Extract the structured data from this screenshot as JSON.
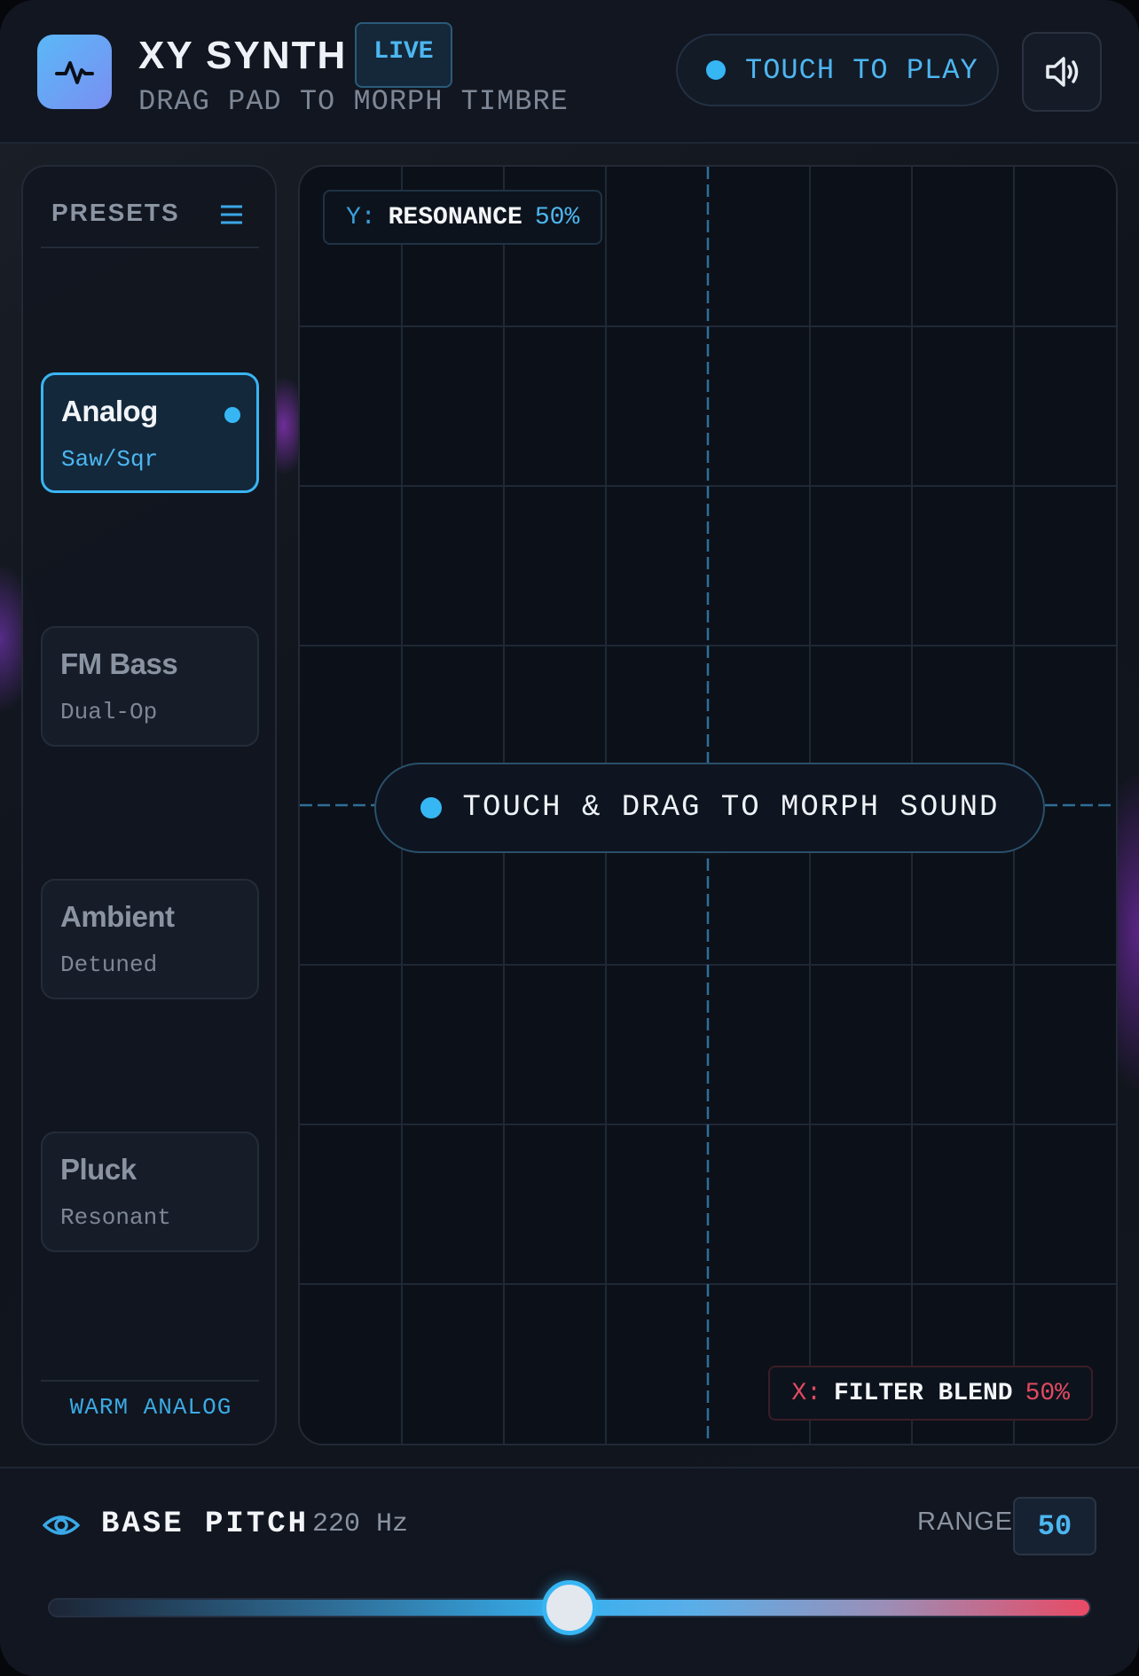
{
  "header": {
    "title": "XY SYNTH",
    "badge": "LIVE",
    "subtitle": "DRAG PAD TO MORPH TIMBRE",
    "touch_to_play": "TOUCH TO PLAY",
    "icons": {
      "logo": "pulse-icon",
      "sound": "speaker-icon"
    }
  },
  "presets": {
    "title": "PRESETS",
    "items": [
      {
        "name": "Analog",
        "sub": "Saw/Sqr",
        "active": true
      },
      {
        "name": "FM Bass",
        "sub": "Dual-Op",
        "active": false
      },
      {
        "name": "Ambient",
        "sub": "Detuned",
        "active": false
      },
      {
        "name": "Pluck",
        "sub": "Resonant",
        "active": false
      }
    ],
    "footer": "WARM ANALOG"
  },
  "pad": {
    "y_axis": {
      "letter": "Y:",
      "name": "RESONANCE",
      "value": "50%"
    },
    "x_axis": {
      "letter": "X:",
      "name": "FILTER BLEND",
      "value": "50%"
    },
    "center_text": "TOUCH & DRAG TO MORPH SOUND",
    "cursor": {
      "x_percent": 50,
      "y_percent": 50
    }
  },
  "bottom": {
    "label": "BASE PITCH",
    "value": "220 Hz",
    "range_label": "RANGE",
    "range_value": "50",
    "slider_percent": 50
  },
  "colors": {
    "accent": "#37b6f4",
    "red": "#e14a62",
    "background": "#0b0f17"
  }
}
